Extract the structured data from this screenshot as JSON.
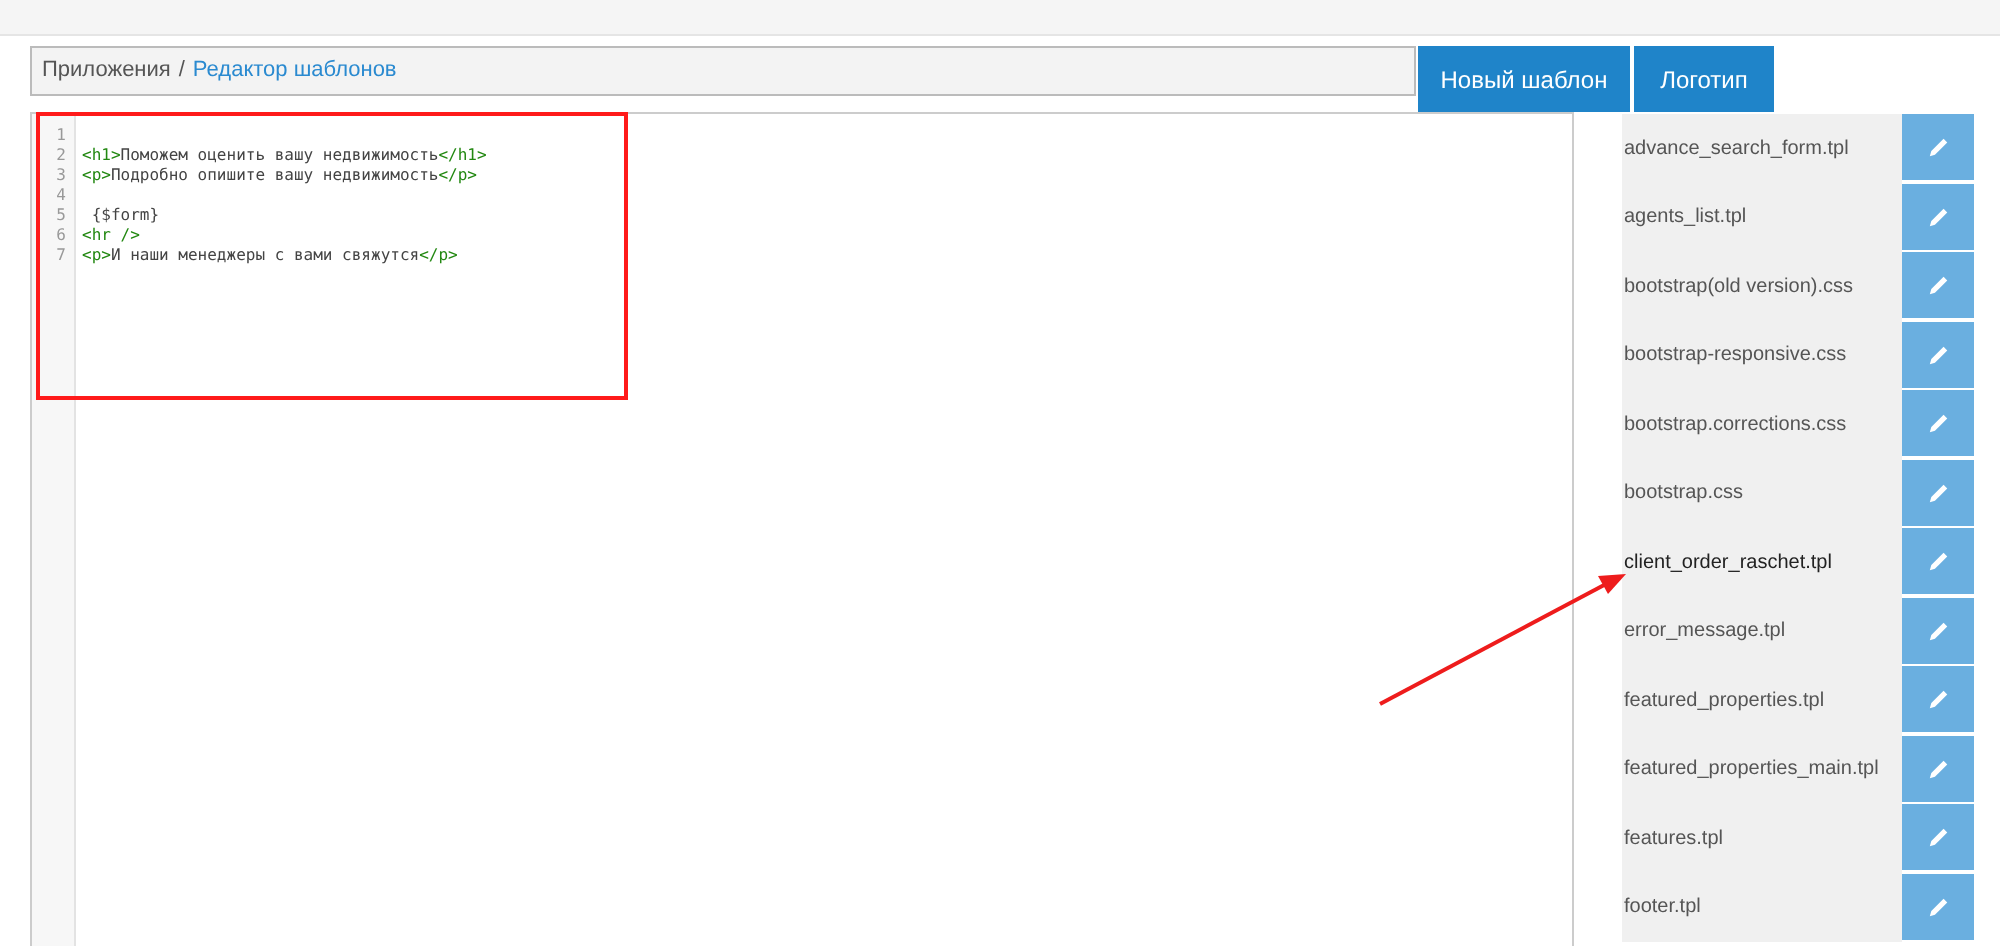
{
  "breadcrumb": {
    "parent": "Приложения",
    "separator": "/",
    "current": "Редактор шаблонов"
  },
  "buttons": [
    "Новый шаблон",
    "Логотип"
  ],
  "editor": {
    "lines": [
      {
        "number": "1"
      },
      {
        "number": "2",
        "code": "<h1>Поможем оценить вашу недвижимость</h1>"
      },
      {
        "number": "3",
        "code": "<p>Подробно опишите вашу недвижимость</p>"
      },
      {
        "number": "4"
      },
      {
        "number": "5",
        "code": " {$form}"
      },
      {
        "number": "6",
        "code": "<hr />"
      },
      {
        "number": "7",
        "code": "<p>И наши менеджеры с вами свяжутся</p>"
      }
    ]
  },
  "files": [
    {
      "name": "advance_search_form.tpl",
      "selected": false
    },
    {
      "name": "agents_list.tpl",
      "selected": false
    },
    {
      "name": "bootstrap(old version).css",
      "selected": false
    },
    {
      "name": "bootstrap-responsive.css",
      "selected": false
    },
    {
      "name": "bootstrap.corrections.css",
      "selected": false
    },
    {
      "name": "bootstrap.css",
      "selected": false
    },
    {
      "name": "client_order_raschet.tpl",
      "selected": true
    },
    {
      "name": "error_message.tpl",
      "selected": false
    },
    {
      "name": "featured_properties.tpl",
      "selected": false
    },
    {
      "name": "featured_properties_main.tpl",
      "selected": false
    },
    {
      "name": "features.tpl",
      "selected": false
    },
    {
      "name": "footer.tpl",
      "selected": false
    }
  ]
}
